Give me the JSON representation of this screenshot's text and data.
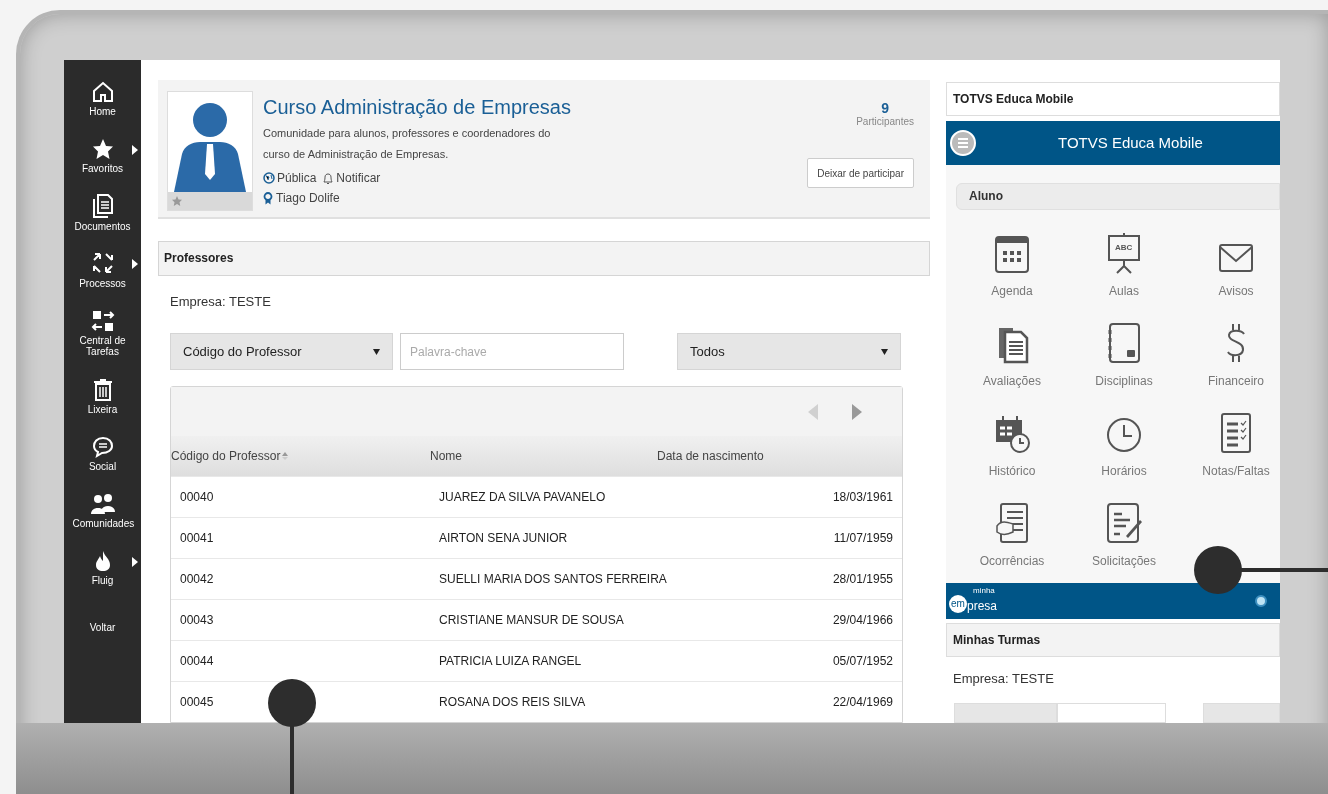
{
  "sidebar": {
    "items": [
      {
        "label": "Home",
        "submenu": false
      },
      {
        "label": "Favoritos",
        "submenu": true
      },
      {
        "label": "Documentos",
        "submenu": false
      },
      {
        "label": "Processos",
        "submenu": true
      },
      {
        "label": "Central de Tarefas",
        "submenu": false
      },
      {
        "label": "Lixeira",
        "submenu": false
      },
      {
        "label": "Social",
        "submenu": false
      },
      {
        "label": "Comunidades",
        "submenu": false
      },
      {
        "label": "Fluig",
        "submenu": true
      },
      {
        "label": "Voltar",
        "submenu": false
      }
    ]
  },
  "community": {
    "title": "Curso Administração de Empresas",
    "description": "Comunidade para alunos, professores e coordenadores do curso de Administração de Empresas.",
    "visibility": "Pública",
    "notify": "Notificar",
    "owner": "Tiago Dolife",
    "participants_count": "9",
    "participants_label": "Participantes",
    "leave_button": "Deixar de participar",
    "favorite": false
  },
  "professores": {
    "title": "Professores",
    "company": "Empresa: TESTE",
    "filters": {
      "field_select": "Código do Professor",
      "keyword": {
        "placeholder": "Palavra-chave"
      },
      "status_select": "Todos"
    },
    "pager": {
      "prev_disabled": true,
      "next_disabled": false
    },
    "table": {
      "columns": [
        {
          "label": "Código do Professor",
          "sorted": true
        },
        {
          "label": "Nome",
          "sorted": false
        },
        {
          "label": "Data de nascimento",
          "sorted": false
        }
      ],
      "rows": [
        [
          "00040",
          "JUAREZ DA SILVA PAVANELO",
          "18/03/1961"
        ],
        [
          "00041",
          "AIRTON SENA JUNIOR",
          "11/07/1959"
        ],
        [
          "00042",
          "SUELLI MARIA DOS SANTOS FERREIRA",
          "28/01/1955"
        ],
        [
          "00043",
          "CRISTIANE MANSUR DE SOUSA",
          "29/04/1966"
        ],
        [
          "00044",
          "PATRICIA LUIZA RANGEL",
          "05/07/1952"
        ],
        [
          "00045",
          "ROSANA DOS REIS SILVA",
          "22/04/1969"
        ]
      ]
    }
  },
  "mobile_panel": {
    "title": "TOTVS Educa Mobile",
    "app_title": "TOTVS Educa Mobile",
    "section": "Aluno",
    "tiles": [
      {
        "label": "Agenda"
      },
      {
        "label": "Aulas"
      },
      {
        "label": "Avisos"
      },
      {
        "label": "Avaliações"
      },
      {
        "label": "Disciplinas"
      },
      {
        "label": "Financeiro"
      },
      {
        "label": "Histórico"
      },
      {
        "label": "Horários"
      },
      {
        "label": "Notas/Faltas"
      },
      {
        "label": "Ocorrências"
      },
      {
        "label": "Solicitações"
      }
    ],
    "board_icon_text": "ABC",
    "logo": {
      "small": "minha",
      "circle": "em",
      "rest": "presa"
    },
    "turmas_title": "Minhas Turmas",
    "company": "Empresa: TESTE"
  }
}
